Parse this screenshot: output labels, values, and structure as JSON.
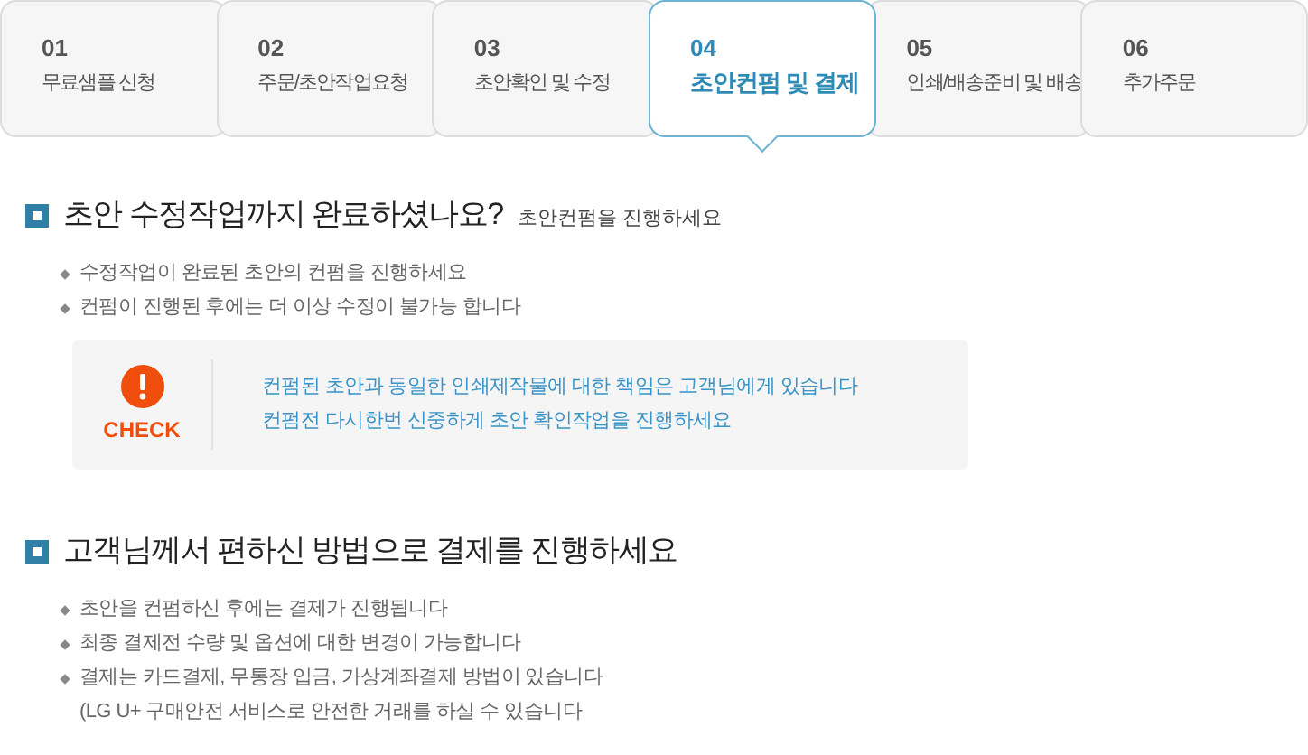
{
  "steps": [
    {
      "number": "01",
      "label": "무료샘플 신청",
      "selected": false
    },
    {
      "number": "02",
      "label": "주문/초안작업요청",
      "selected": false
    },
    {
      "number": "03",
      "label": "초안확인 및 수정",
      "selected": false
    },
    {
      "number": "04",
      "label": "초안컨펌 및 결제",
      "selected": true
    },
    {
      "number": "05",
      "label": "인쇄/배송준비 및 배송",
      "selected": false
    },
    {
      "number": "06",
      "label": "추가주문",
      "selected": false
    }
  ],
  "sections": [
    {
      "title": "초안 수정작업까지 완료하셨나요?",
      "subtitle": "초안컨펌을 진행하세요",
      "bullets": [
        "수정작업이 완료된 초안의 컨펌을 진행하세요",
        "컨펌이 진행된 후에는 더 이상 수정이 불가능 합니다"
      ],
      "notice": {
        "label": "CHECK",
        "lines": [
          "컨펌된 초안과 동일한 인쇄제작물에 대한 책임은 고객님에게 있습니다",
          "컨펌전 다시한번 신중하게 초안 확인작업을 진행하세요"
        ]
      }
    },
    {
      "title": "고객님께서 편하신 방법으로 결제를 진행하세요",
      "bullets": [
        "초안을 컨펌하신 후에는 결제가 진행됩니다",
        "최종 결제전 수량 및 옵션에 대한 변경이 가능합니다",
        "결제는 카드결제, 무통장 입금, 가상계좌결제 방법이 있습니다\n(LG U+ 구매안전 서비스로 안전한 거래를 하실 수 있습니다"
      ]
    }
  ]
}
